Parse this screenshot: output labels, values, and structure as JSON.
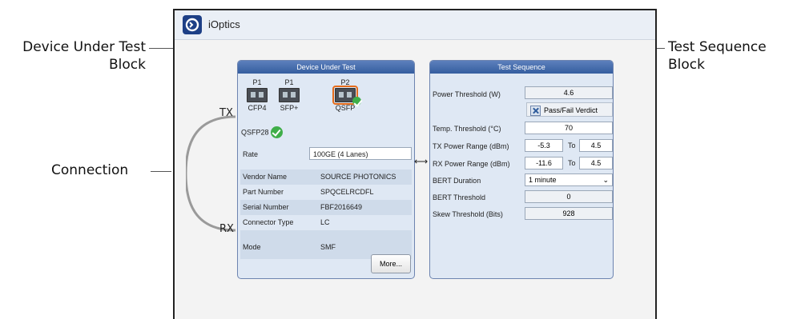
{
  "callouts": {
    "dut_line1": "Device Under Test",
    "dut_line2": "Block",
    "seq_line1": "Test Sequence",
    "seq_line2": "Block",
    "connection": "Connection"
  },
  "app": {
    "title": "iOptics"
  },
  "dut": {
    "header": "Device Under Test",
    "ports": [
      {
        "num": "P1",
        "type": "CFP4"
      },
      {
        "num": "P1",
        "type": "SFP+"
      },
      {
        "num": "P2",
        "type": "QSFP"
      }
    ],
    "module": "QSFP28",
    "rate_label": "Rate",
    "rate_value": "100GE (4 Lanes)",
    "info": [
      {
        "k": "Vendor Name",
        "v": "SOURCE PHOTONICS"
      },
      {
        "k": "Part Number",
        "v": "SPQCELRCDFL"
      },
      {
        "k": "Serial Number",
        "v": "FBF2016649"
      },
      {
        "k": "Connector Type",
        "v": "LC"
      },
      {
        "k": "Mode",
        "v": "SMF"
      }
    ],
    "more_button": "More..."
  },
  "connection": {
    "tx": "TX",
    "rx": "RX"
  },
  "seq": {
    "header": "Test Sequence",
    "power_threshold_label": "Power Threshold (W)",
    "power_threshold_value": "4.6",
    "pass_fail_label": "Pass/Fail Verdict",
    "temp_label": "Temp. Threshold (°C)",
    "temp_value": "70",
    "tx_label": "TX Power Range (dBm)",
    "tx_min": "-5.3",
    "tx_max": "4.5",
    "rx_label": "RX Power Range (dBm)",
    "rx_min": "-11.6",
    "rx_max": "4.5",
    "to_label": "To",
    "bert_duration_label": "BERT Duration",
    "bert_duration_value": "1 minute",
    "bert_threshold_label": "BERT Threshold",
    "bert_threshold_value": "0",
    "skew_label": "Skew Threshold (Bits)",
    "skew_value": "928"
  }
}
